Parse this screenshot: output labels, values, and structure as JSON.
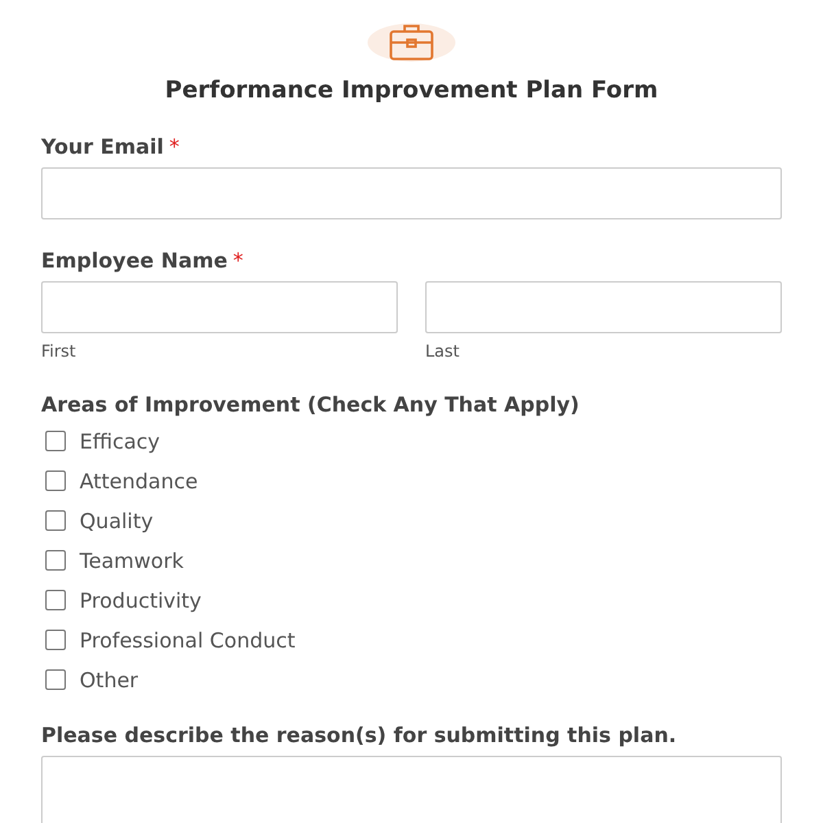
{
  "form": {
    "title": "Performance Improvement Plan Form"
  },
  "fields": [
    {
      "kind": "text",
      "label": "Your Email",
      "required_mark": "*"
    },
    {
      "kind": "name",
      "label": "Employee Name",
      "required_mark": "*",
      "parts": [
        {
          "sublabel": "First"
        },
        {
          "sublabel": "Last"
        }
      ]
    },
    {
      "kind": "checkboxes",
      "label": "Areas of Improvement (Check Any That Apply)",
      "options": [
        {
          "label": "Efficacy",
          "checked": false
        },
        {
          "label": "Attendance",
          "checked": false
        },
        {
          "label": "Quality",
          "checked": false
        },
        {
          "label": "Teamwork",
          "checked": false
        },
        {
          "label": "Productivity",
          "checked": false
        },
        {
          "label": "Professional Conduct",
          "checked": false
        },
        {
          "label": "Other",
          "checked": false
        }
      ]
    },
    {
      "kind": "textarea",
      "label": "Please describe the reason(s) for submitting this plan."
    }
  ]
}
